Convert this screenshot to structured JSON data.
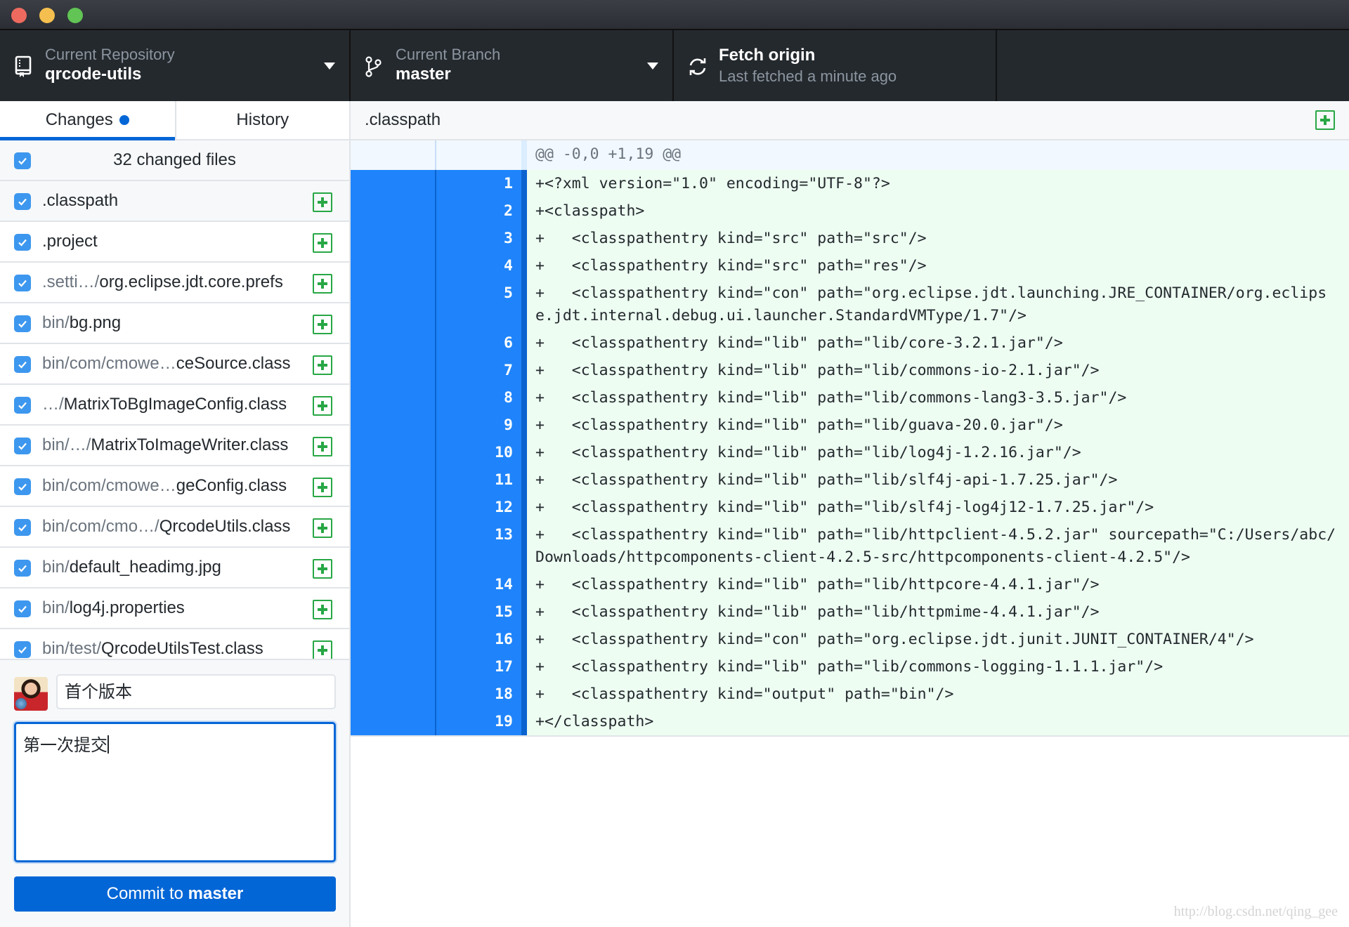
{
  "window": {
    "buttons": [
      "close",
      "minimize",
      "maximize"
    ]
  },
  "toolbar": {
    "repository": {
      "label": "Current Repository",
      "value": "qrcode-utils",
      "icon": "repo-icon"
    },
    "branch": {
      "label": "Current Branch",
      "value": "master",
      "icon": "git-branch-icon"
    },
    "fetch": {
      "title": "Fetch origin",
      "subtitle": "Last fetched a minute ago",
      "icon": "sync-icon"
    }
  },
  "tabs": [
    {
      "label": "Changes",
      "active": true,
      "has_indicator": true
    },
    {
      "label": "History",
      "active": false
    }
  ],
  "changes": {
    "count_label": "32 changed files",
    "all_checked": true,
    "files": [
      {
        "dir": "",
        "name": ".classpath",
        "status": "added",
        "checked": true,
        "selected": true
      },
      {
        "dir": "",
        "name": ".project",
        "status": "added",
        "checked": true
      },
      {
        "dir": ".setti…/",
        "name": "org.eclipse.jdt.core.prefs",
        "status": "added",
        "checked": true
      },
      {
        "dir": "bin/",
        "name": "bg.png",
        "status": "added",
        "checked": true
      },
      {
        "dir": "bin/com/cmowe…",
        "name": "ceSource.class",
        "status": "added",
        "checked": true
      },
      {
        "dir": "…/",
        "name": "MatrixToBgImageConfig.class",
        "status": "added",
        "checked": true
      },
      {
        "dir": "bin/…/",
        "name": "MatrixToImageWriter.class",
        "status": "added",
        "checked": true
      },
      {
        "dir": "bin/com/cmowe…",
        "name": "geConfig.class",
        "status": "added",
        "checked": true
      },
      {
        "dir": "bin/com/cmo…/",
        "name": "QrcodeUtils.class",
        "status": "added",
        "checked": true
      },
      {
        "dir": "bin/",
        "name": "default_headimg.jpg",
        "status": "added",
        "checked": true
      },
      {
        "dir": "bin/",
        "name": "log4j.properties",
        "status": "added",
        "checked": true
      },
      {
        "dir": "bin/test/",
        "name": "QrcodeUtilsTest.class",
        "status": "added",
        "checked": true
      }
    ]
  },
  "commit": {
    "summary": "首个版本",
    "description": "第一次提交",
    "button_prefix": "Commit to ",
    "button_branch": "master"
  },
  "diff": {
    "file": ".classpath",
    "status": "added",
    "hunk_header": "@@ -0,0 +1,19 @@",
    "lines": [
      {
        "new": "1",
        "text": "+<?xml version=\"1.0\" encoding=\"UTF-8\"?>"
      },
      {
        "new": "2",
        "text": "+<classpath>"
      },
      {
        "new": "3",
        "text": "+   <classpathentry kind=\"src\" path=\"src\"/>"
      },
      {
        "new": "4",
        "text": "+   <classpathentry kind=\"src\" path=\"res\"/>"
      },
      {
        "new": "5",
        "text": "+   <classpathentry kind=\"con\" path=\"org.eclipse.jdt.launching.JRE_CONTAINER/org.eclipse.jdt.internal.debug.ui.launcher.StandardVMType/1.7\"/>"
      },
      {
        "new": "6",
        "text": "+   <classpathentry kind=\"lib\" path=\"lib/core-3.2.1.jar\"/>"
      },
      {
        "new": "7",
        "text": "+   <classpathentry kind=\"lib\" path=\"lib/commons-io-2.1.jar\"/>"
      },
      {
        "new": "8",
        "text": "+   <classpathentry kind=\"lib\" path=\"lib/commons-lang3-3.5.jar\"/>"
      },
      {
        "new": "9",
        "text": "+   <classpathentry kind=\"lib\" path=\"lib/guava-20.0.jar\"/>"
      },
      {
        "new": "10",
        "text": "+   <classpathentry kind=\"lib\" path=\"lib/log4j-1.2.16.jar\"/>"
      },
      {
        "new": "11",
        "text": "+   <classpathentry kind=\"lib\" path=\"lib/slf4j-api-1.7.25.jar\"/>"
      },
      {
        "new": "12",
        "text": "+   <classpathentry kind=\"lib\" path=\"lib/slf4j-log4j12-1.7.25.jar\"/>"
      },
      {
        "new": "13",
        "text": "+   <classpathentry kind=\"lib\" path=\"lib/httpclient-4.5.2.jar\" sourcepath=\"C:/Users/abc/Downloads/httpcomponents-client-4.2.5-src/httpcomponents-client-4.2.5\"/>"
      },
      {
        "new": "14",
        "text": "+   <classpathentry kind=\"lib\" path=\"lib/httpcore-4.4.1.jar\"/>"
      },
      {
        "new": "15",
        "text": "+   <classpathentry kind=\"lib\" path=\"lib/httpmime-4.4.1.jar\"/>"
      },
      {
        "new": "16",
        "text": "+   <classpathentry kind=\"con\" path=\"org.eclipse.jdt.junit.JUNIT_CONTAINER/4\"/>"
      },
      {
        "new": "17",
        "text": "+   <classpathentry kind=\"lib\" path=\"lib/commons-logging-1.1.1.jar\"/>"
      },
      {
        "new": "18",
        "text": "+   <classpathentry kind=\"output\" path=\"bin\"/>"
      },
      {
        "new": "19",
        "text": "+</classpath>"
      }
    ]
  },
  "watermark": "http://blog.csdn.net/qing_gee",
  "colors": {
    "accent": "#0366d6",
    "added_status": "#28a745",
    "toolbar_bg": "#24292e",
    "gutter_added": "#1f84fb",
    "line_added_bg": "#edfdf2"
  }
}
